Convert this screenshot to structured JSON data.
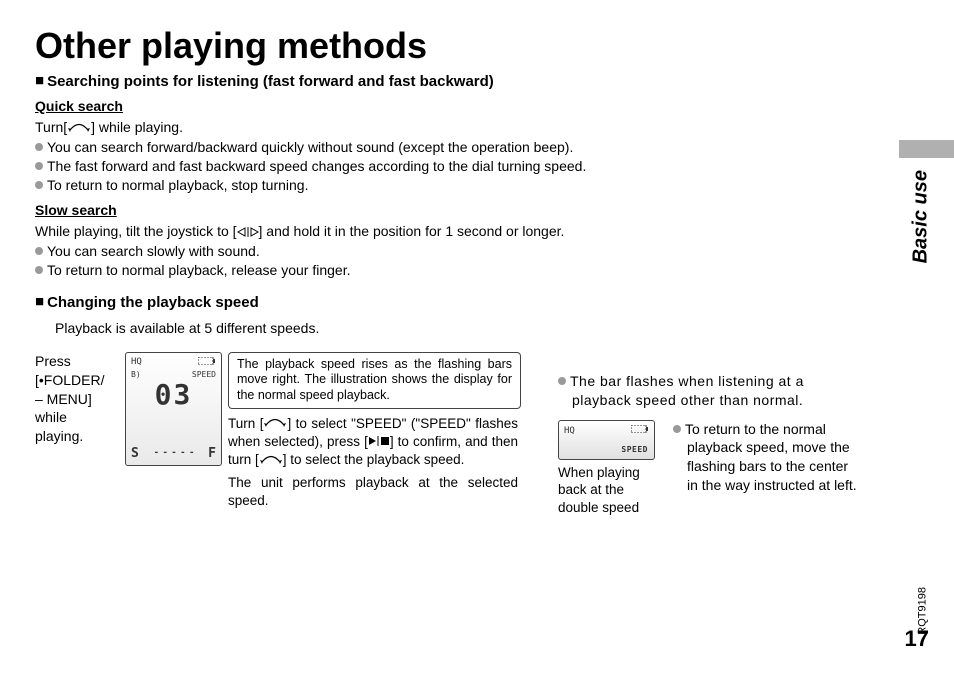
{
  "title": "Other playing methods",
  "section1": {
    "heading": "Searching points for listening (fast forward and fast backward)",
    "quick": {
      "heading": "Quick search",
      "line1_a": "Turn[",
      "line1_b": "] while playing.",
      "b1": "You can search forward/backward quickly without sound (except the operation beep).",
      "b2": "The fast forward and fast backward speed changes according to the dial turning speed.",
      "b3": "To return to normal playback, stop turning."
    },
    "slow": {
      "heading": "Slow search",
      "line1_a": "While playing, tilt the joystick to [",
      "line1_b": "] and hold it in the position for 1 second or longer.",
      "b1": "You can search slowly with sound.",
      "b2": "To return to normal playback, release your finger."
    }
  },
  "section2": {
    "heading": "Changing the playback speed",
    "sub": "Playback is available at 5 different speeds.",
    "press_a": "Press",
    "press_b": "[•FOLDER/",
    "press_c": "– MENU]",
    "press_d": "while",
    "press_e": "playing.",
    "lcd": {
      "hq": "HQ",
      "batt_icon": "battery-icon",
      "b": "B)",
      "speed_label": "SPEED",
      "digits": "03",
      "S": "S",
      "F": "F"
    },
    "info_box": "The playback speed rises as the flashing bars move right. The illustration shows the display for the normal speed playback.",
    "mid_a": "Turn [",
    "mid_b": "] to select \"SPEED\" (\"SPEED\" flashes when selected), press [",
    "mid_c": "] to confirm, and then turn [",
    "mid_d": "] to select the playback speed.",
    "mid_e": "The unit performs playback at the selected speed.",
    "right_b1": "The bar flashes when listening at a playback speed other than normal.",
    "caption": "When playing back at the double speed",
    "right_b2": "To return to the normal playback speed, move the flashing bars to the center in the way instructed at left."
  },
  "side": {
    "label": "Basic use",
    "docnum": "RQT9198",
    "page": "17"
  }
}
